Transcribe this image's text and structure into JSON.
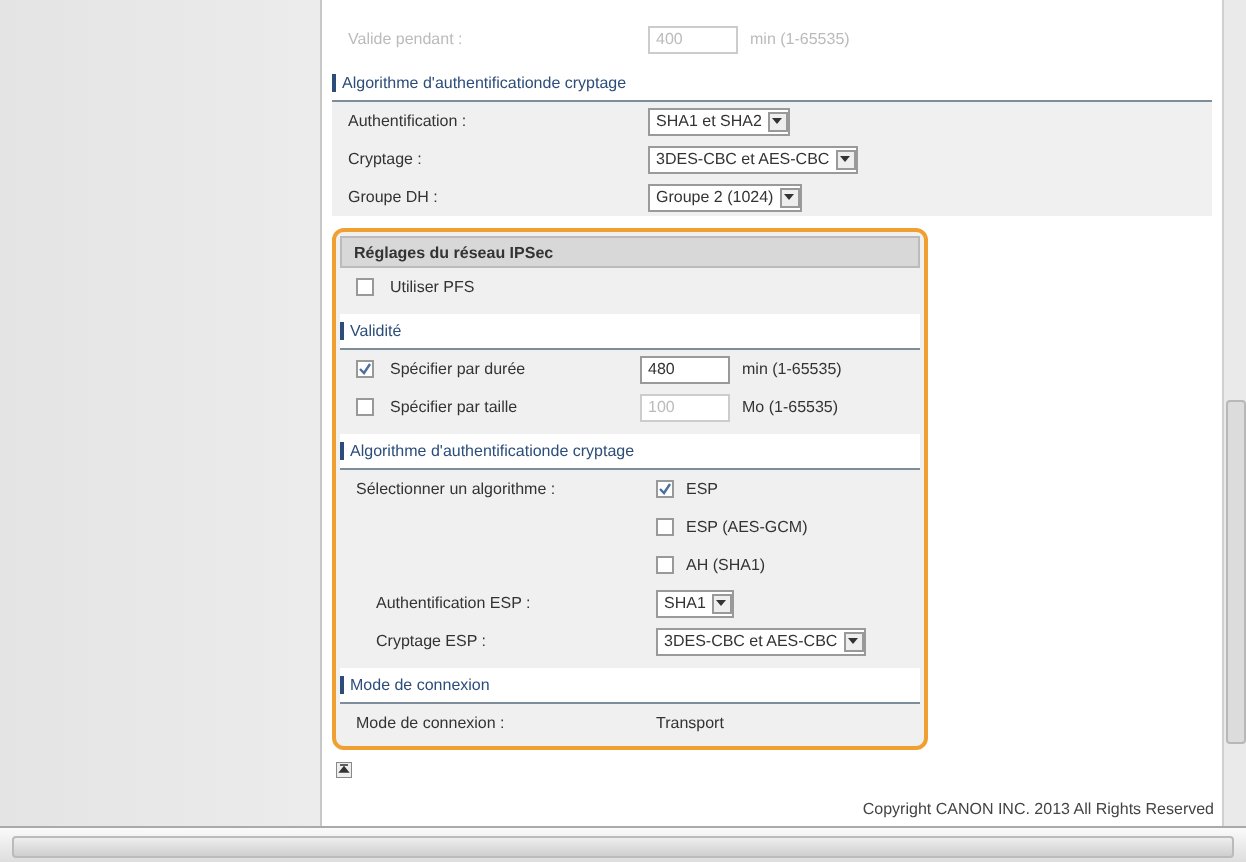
{
  "top_row": {
    "label": "Valide pendant :",
    "value": "400",
    "unit": "min (1-65535)",
    "disabled": true
  },
  "sections": [
    {
      "title": "Algorithme d'authentificationde cryptage",
      "kind": "bar",
      "rows": [
        {
          "kind": "select",
          "label": "Authentification :",
          "value": "SHA1 et SHA2"
        },
        {
          "kind": "select",
          "label": "Cryptage :",
          "value": "3DES-CBC et AES-CBC"
        },
        {
          "kind": "select",
          "label": "Groupe DH :",
          "value": "Groupe 2 (1024)"
        }
      ]
    }
  ],
  "highlighted_sections": [
    {
      "title": "Réglages du réseau IPSec",
      "kind": "band",
      "rows": [
        {
          "kind": "checkbox",
          "label": "Utiliser PFS",
          "checked": false
        }
      ]
    },
    {
      "title": "Validité",
      "kind": "bar",
      "rows": [
        {
          "kind": "checkbox",
          "label": "Spécifier par durée",
          "checked": true,
          "field": {
            "value": "480",
            "disabled": false
          },
          "unit": "min (1-65535)"
        },
        {
          "kind": "checkbox",
          "label": "Spécifier par taille",
          "checked": false,
          "field": {
            "value": "100",
            "disabled": true
          },
          "unit": "Mo (1-65535)"
        }
      ]
    },
    {
      "title": "Algorithme d'authentificationde cryptage",
      "kind": "bar",
      "rows": [
        {
          "kind": "option",
          "label": "Sélectionner un algorithme :",
          "option": "ESP",
          "checked": true
        },
        {
          "kind": "option",
          "option": "ESP (AES-GCM)",
          "checked": false
        },
        {
          "kind": "option",
          "option": "AH (SHA1)",
          "checked": false
        },
        {
          "kind": "subselect",
          "label": "Authentification ESP :",
          "value": "SHA1"
        },
        {
          "kind": "subselect",
          "label": "Cryptage ESP :",
          "value": "3DES-CBC et AES-CBC"
        }
      ]
    },
    {
      "title": "Mode de connexion",
      "kind": "bar",
      "rows": [
        {
          "kind": "text",
          "label": "Mode de connexion :",
          "value": "Transport"
        }
      ]
    }
  ],
  "copyright": "Copyright CANON INC. 2013 All Rights Reserved"
}
